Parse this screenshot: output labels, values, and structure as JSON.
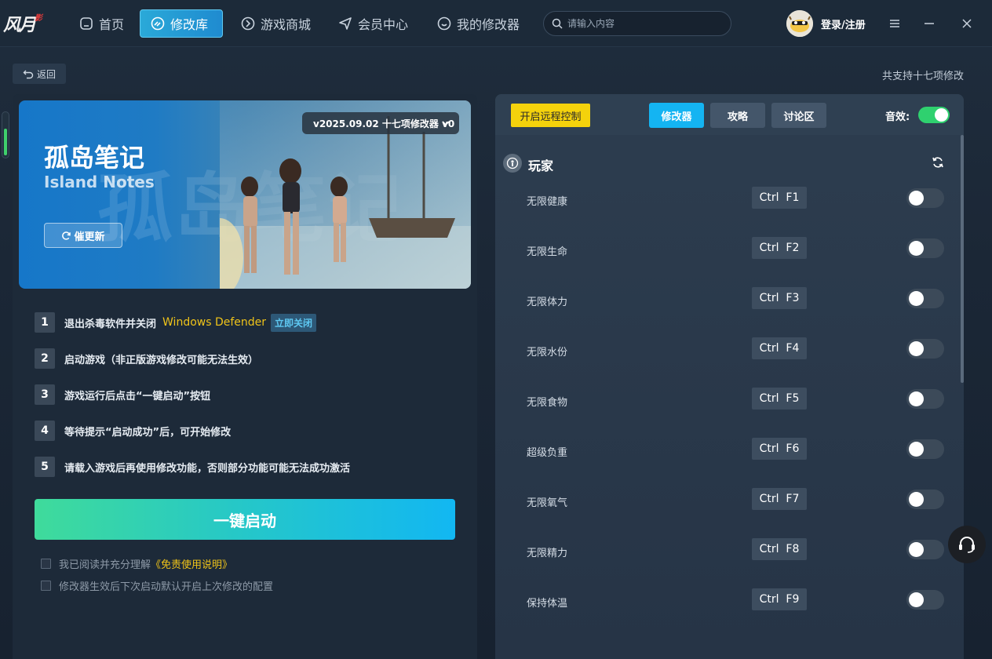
{
  "app": {
    "logo_text": "风月",
    "logo_seal": "影"
  },
  "nav": {
    "items": [
      {
        "label": "首页",
        "icon": "home-icon"
      },
      {
        "label": "修改库",
        "icon": "library-icon",
        "active": true
      },
      {
        "label": "游戏商城",
        "icon": "store-icon"
      },
      {
        "label": "会员中心",
        "icon": "vip-icon"
      },
      {
        "label": "我的修改器",
        "icon": "my-trainers-icon"
      }
    ]
  },
  "search": {
    "placeholder": "请输入内容"
  },
  "user": {
    "login_label": "登录/注册"
  },
  "subheader": {
    "back_label": "返回",
    "support_count": "共支持十七项修改"
  },
  "game": {
    "title": "孤岛笔记",
    "subtitle": "Island Notes",
    "bg_text": "孤岛笔记",
    "urge_label": "催更新",
    "version": "v2025.09.02 十七项修改器 v0"
  },
  "steps": [
    {
      "num": "1",
      "text": "退出杀毒软件并关闭",
      "highlight": "Windows Defender",
      "tag": "立即关闭"
    },
    {
      "num": "2",
      "text": "启动游戏（非正版游戏修改可能无法生效）"
    },
    {
      "num": "3",
      "text": "游戏运行后点击“一键启动”按钮"
    },
    {
      "num": "4",
      "text": "等待提示“启动成功”后，可开始修改"
    },
    {
      "num": "5",
      "text": "请载入游戏后再使用修改功能，否则部分功能可能无法成功激活"
    }
  ],
  "start_button": "一键启动",
  "agreements": [
    {
      "text": "我已阅读并充分理解",
      "link": "《免责使用说明》"
    },
    {
      "text": "修改器生效后下次启动默认开启上次修改的配置"
    }
  ],
  "right": {
    "remote_label": "开启远程控制",
    "tabs": [
      "修改器",
      "攻略",
      "讨论区"
    ],
    "sound_label": "音效:",
    "sound_on": true,
    "section_title": "玩家",
    "cheats": [
      {
        "name": "无限健康",
        "hotkey": "Ctrl  F1",
        "enabled": false
      },
      {
        "name": "无限生命",
        "hotkey": "Ctrl  F2",
        "enabled": false
      },
      {
        "name": "无限体力",
        "hotkey": "Ctrl  F3",
        "enabled": false
      },
      {
        "name": "无限水份",
        "hotkey": "Ctrl  F4",
        "enabled": false
      },
      {
        "name": "无限食物",
        "hotkey": "Ctrl  F5",
        "enabled": false
      },
      {
        "name": "超级负重",
        "hotkey": "Ctrl  F6",
        "enabled": false
      },
      {
        "name": "无限氧气",
        "hotkey": "Ctrl  F7",
        "enabled": false
      },
      {
        "name": "无限精力",
        "hotkey": "Ctrl  F8",
        "enabled": false
      },
      {
        "name": "保持体温",
        "hotkey": "Ctrl  F9",
        "enabled": false
      }
    ]
  },
  "colors": {
    "accent": "#14b4f2",
    "highlight": "#f0c419",
    "remote": "#f4d20c",
    "toggle_on": "#2fd16f"
  }
}
